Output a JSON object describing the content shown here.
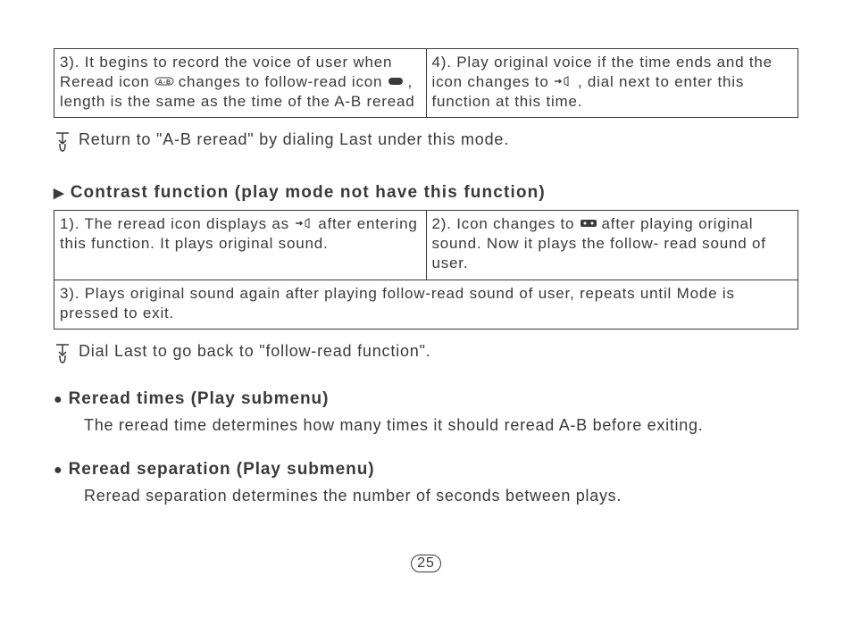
{
  "top_table": {
    "c3": {
      "num": "3).",
      "t1": "It begins to record the voice of user when Reread icon",
      "icon1": "reread-ab-icon",
      "t2": "changes to follow-read icon",
      "icon2": "follow-read-icon",
      "t3": ", length is the same as the time of the A-B reread"
    },
    "c4": {
      "num": " 4).",
      "t1": "Play original voice if the time ends and the icon changes to",
      "icon1": "play-arrow-speaker-icon",
      "t2": ", dial next to enter this function at this time."
    }
  },
  "tip1": "Return to \"A-B reread\" by dialing Last under this mode.",
  "heading1": "Contrast function (play mode not have this function)",
  "contrast_table": {
    "c1": {
      "num": "1).",
      "t1": "The reread icon displays as",
      "icon1": "play-arrow-speaker-icon",
      "t2": "after entering this function. It plays original sound."
    },
    "c2": {
      "num": "2).",
      "t1": "Icon changes to",
      "icon1": "cassette-icon",
      "t2": " after playing original sound. Now it plays the follow- read sound of user."
    },
    "c3": {
      "num": "3).",
      "t1": "Plays original sound again after playing follow-read sound of user, repeats until Mode is pressed to exit."
    }
  },
  "tip2": "Dial Last to go back to \"follow-read function\".",
  "sub1": {
    "title": "Reread times (Play submenu)",
    "body": "The reread time determines how many times it should reread A-B before exiting."
  },
  "sub2": {
    "title": "Reread separation (Play submenu)",
    "body": "Reread separation determines the number of seconds between plays."
  },
  "page_number": "25"
}
